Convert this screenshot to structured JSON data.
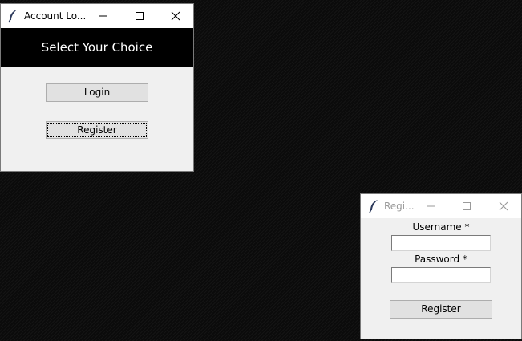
{
  "account_window": {
    "title": "Account Lo...",
    "banner": "Select Your Choice",
    "login_button": "Login",
    "register_button": "Register"
  },
  "register_window": {
    "title": "Regi...",
    "username_label": "Username *",
    "username_value": "",
    "password_label": "Password *",
    "password_value": "",
    "register_button": "Register"
  },
  "icons": {
    "app": "feather-icon",
    "minimize": "minimize-icon",
    "maximize": "maximize-icon",
    "close": "close-icon"
  },
  "colors": {
    "desktop": "#0d0d0d",
    "window_bg": "#f0f0f0",
    "banner_bg": "#000000",
    "banner_text": "#ffffff",
    "button_bg": "#e1e1e1"
  }
}
